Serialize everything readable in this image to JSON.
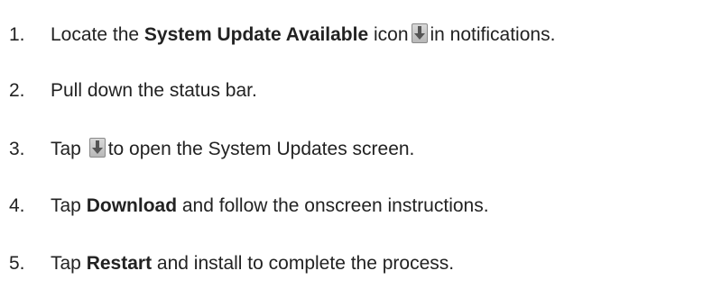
{
  "steps": [
    {
      "number": "1.",
      "parts": [
        {
          "text": "Locate the "
        },
        {
          "bold": "System Update Available"
        },
        {
          "text": " icon"
        },
        {
          "icon": "system-update-icon"
        },
        {
          "text": "in notifications."
        }
      ]
    },
    {
      "number": "2.",
      "parts": [
        {
          "text": "Pull down the status bar."
        }
      ]
    },
    {
      "number": "3.",
      "parts": [
        {
          "text": "Tap "
        },
        {
          "icon": "system-update-icon"
        },
        {
          "text": "to open the System Updates screen."
        }
      ]
    },
    {
      "number": "4.",
      "parts": [
        {
          "text": "Tap "
        },
        {
          "bold": "Download"
        },
        {
          "text": " and follow the onscreen instructions."
        }
      ]
    },
    {
      "number": "5.",
      "parts": [
        {
          "text": "Tap "
        },
        {
          "bold": "Restart"
        },
        {
          "text": " and install to complete the process."
        }
      ]
    }
  ],
  "colors": {
    "text": "#222222",
    "icon_bg": "#c8c8c8",
    "icon_arrow": "#555555"
  }
}
